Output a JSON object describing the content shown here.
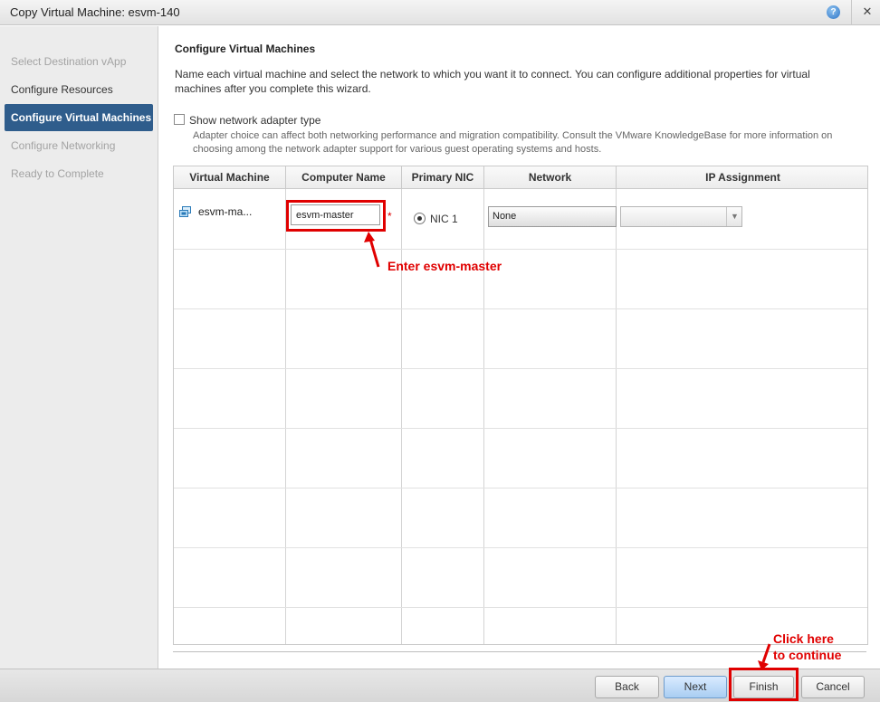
{
  "window": {
    "title": "Copy Virtual Machine: esvm-140"
  },
  "steps": [
    {
      "label": "Select Destination vApp",
      "state": "disabled"
    },
    {
      "label": "Configure Resources",
      "state": "done"
    },
    {
      "label": "Configure Virtual Machines",
      "state": "active"
    },
    {
      "label": "Configure Networking",
      "state": "disabled"
    },
    {
      "label": "Ready to Complete",
      "state": "disabled"
    }
  ],
  "main": {
    "heading": "Configure Virtual Machines",
    "description": "Name each virtual machine and select the network to which you want it to connect. You can configure additional properties for virtual machines after you complete this wizard.",
    "show_adapter_label": "Show network adapter type",
    "show_adapter_checked": false,
    "adapter_note": "Adapter choice can affect both networking performance and migration compatibility. Consult the VMware KnowledgeBase for more information on choosing among the network adapter support for various guest operating systems and hosts."
  },
  "table": {
    "columns": [
      "Virtual Machine",
      "Computer Name",
      "Primary NIC",
      "Network",
      "IP Assignment"
    ],
    "rows": [
      {
        "vm": "esvm-ma...",
        "computer_name": "esvm-master",
        "required_mark": "*",
        "primary_nic": "NIC 1",
        "network": "None",
        "ip_assignment": ""
      }
    ]
  },
  "annotations": {
    "enter_name": "Enter esvm-master",
    "click_line1": "Click here",
    "click_line2": "to continue",
    "color": "#e00000"
  },
  "buttons": {
    "back": "Back",
    "next": "Next",
    "finish": "Finish",
    "cancel": "Cancel"
  },
  "colors": {
    "active_step": "#2f5d8c",
    "primary_button": "#a9cdf2"
  },
  "icons": {
    "help": "help-icon",
    "close": "close-icon",
    "vm": "virtual-machine-icon"
  }
}
